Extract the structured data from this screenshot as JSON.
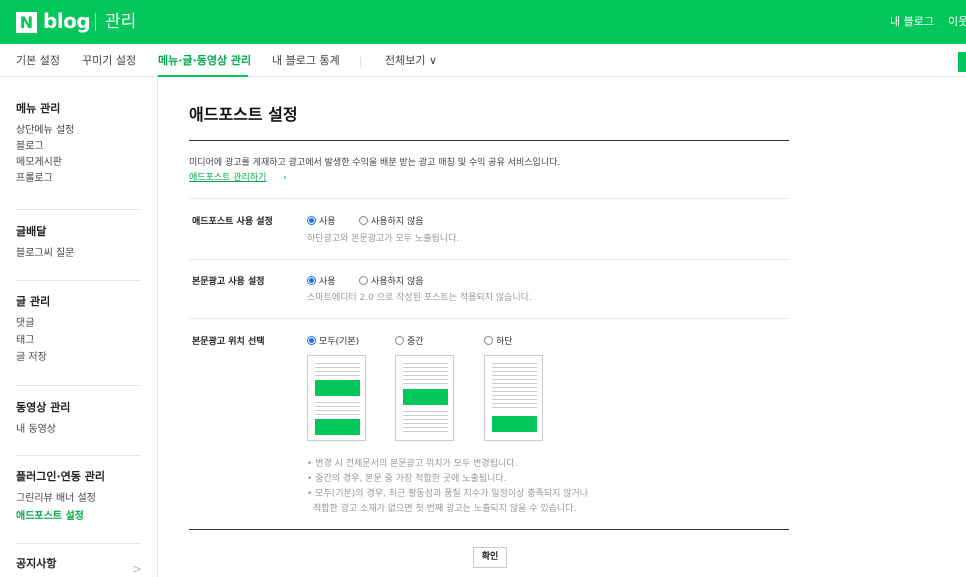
{
  "header": {
    "logo_n": "N",
    "logo_word": "blog",
    "title": "관리",
    "my_blog": "내 블로그",
    "other": "이웃"
  },
  "nav": {
    "items": [
      "기본 설정",
      "꾸미기 설정",
      "메뉴·글·동영상 관리",
      "내 블로그 통계",
      "전체보기 ∨"
    ],
    "active_index": 2
  },
  "sidebar": {
    "sections": [
      {
        "title": "메뉴 관리",
        "items": [
          "상단메뉴 설정",
          "블로그",
          "메모게시판",
          "프롤로그"
        ]
      },
      {
        "title": "글배달",
        "items": [
          "블로그씨 질문"
        ]
      },
      {
        "title": "글 관리",
        "items": [
          "댓글",
          "태그",
          "글 저장"
        ]
      },
      {
        "title": "동영상 관리",
        "items": [
          "내 동영상"
        ]
      },
      {
        "title": "플러그인·연동 관리",
        "items": [
          "그린리뷰 배너 설정",
          "애드포스트 설정"
        ]
      },
      {
        "title": "공지사항",
        "items": []
      }
    ],
    "active_item": "애드포스트 설정",
    "notice_chevron": ">"
  },
  "main": {
    "title": "애드포스트 설정",
    "description": "미디어에 광고를 게재하고 광고에서 발생한 수익을 배분 받는 광고 매칭 및 수익 공유 서비스입니다.",
    "manage_link": "애드포스트 관리하기",
    "manage_arrow": "›",
    "rows": [
      {
        "label": "애드포스트 사용 설정",
        "options": [
          "사용",
          "사용하지 않음"
        ],
        "selected": 0,
        "help": "하단광고와 본문광고가 모두 노출됩니다."
      },
      {
        "label": "본문광고 사용 설정",
        "options": [
          "사용",
          "사용하지 않음"
        ],
        "selected": 0,
        "help": "스마트에디터 2.0 으로 작성된 포스트는 적용되지 않습니다."
      },
      {
        "label": "본문광고 위치 선택",
        "options": [
          "모두(기본)",
          "중간",
          "하단"
        ],
        "selected": 0,
        "help": ""
      }
    ],
    "notes": [
      "• 변경 시 전체문서의 본문광고 위치가 모두 변경됩니다.",
      "• 중간의 경우, 본문 중 가장 적합한 곳에 노출됩니다.",
      "• 모두(기본)의 경우, 최근 활동성과 품질 지수가 일정이상 충족되지 않거나",
      "적합한 광고 소재가 없으면 첫 번째 광고는 노출되지 않을 수 있습니다."
    ],
    "confirm_button": "확인"
  },
  "colors": {
    "brand": "#03c75a",
    "link": "#03a94d",
    "radio": "#1a73e8"
  }
}
